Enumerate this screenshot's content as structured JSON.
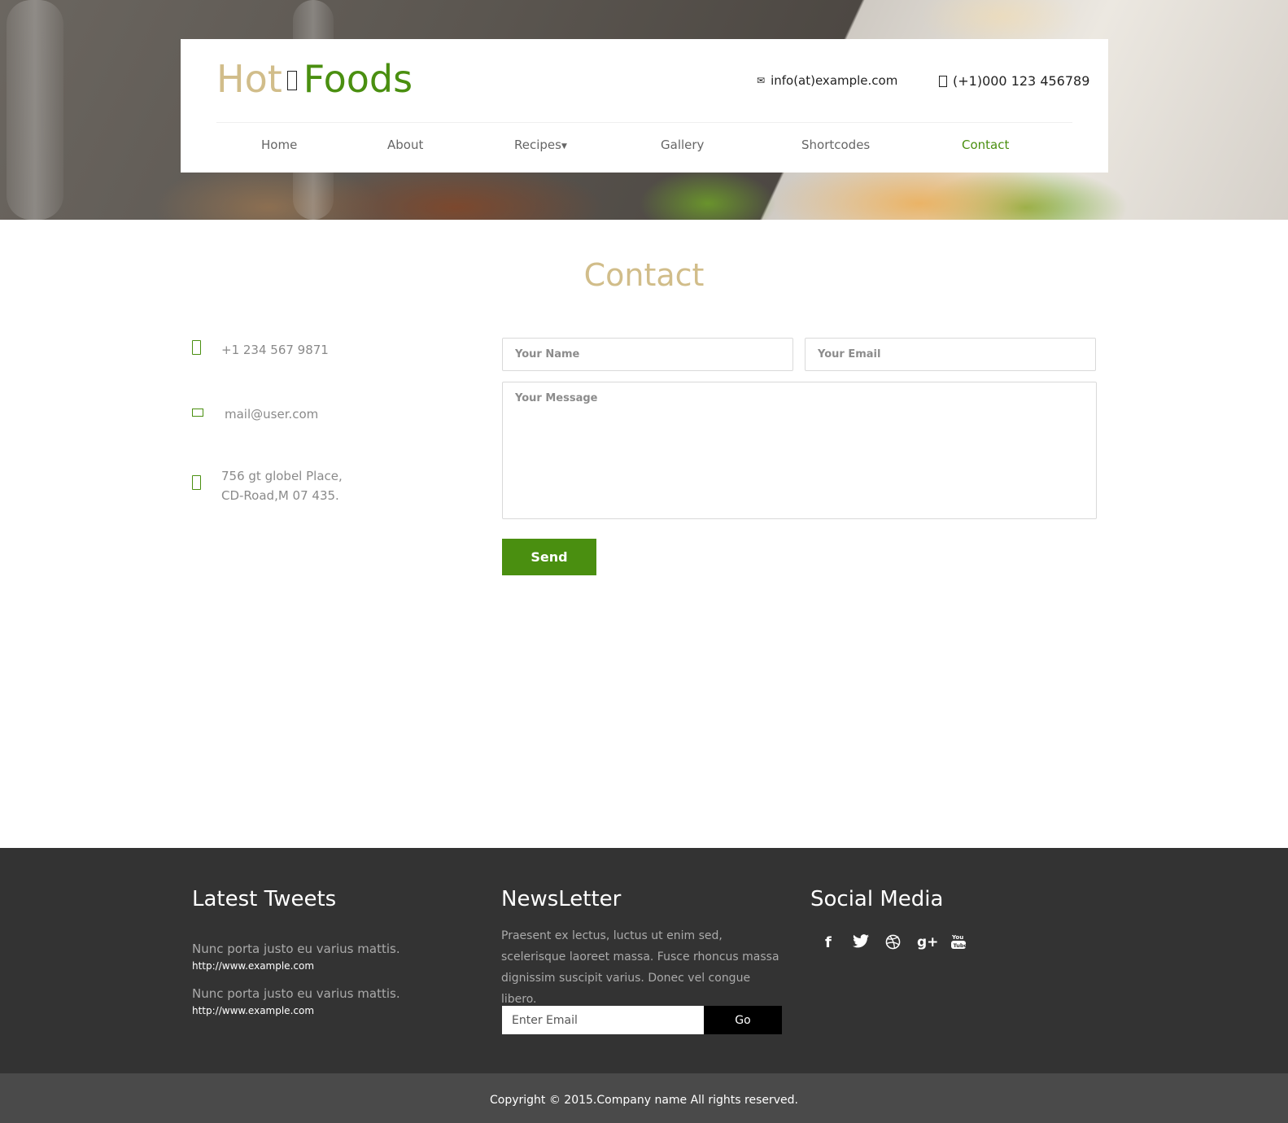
{
  "header": {
    "logo": {
      "part1": "Hot",
      "part2": "Foods"
    },
    "email": "info(at)example.com",
    "phone": "(+1)000 123 456789",
    "nav": [
      {
        "label": "Home"
      },
      {
        "label": "About"
      },
      {
        "label": "Recipes"
      },
      {
        "label": "Gallery"
      },
      {
        "label": "Shortcodes"
      },
      {
        "label": "Contact",
        "active": true
      }
    ]
  },
  "contact": {
    "title": "Contact",
    "phone": "+1 234 567 9871",
    "email": "mail@user.com",
    "address_line1": "756 gt globel Place,",
    "address_line2": "CD-Road,M 07 435.",
    "form": {
      "name_placeholder": "Your Name",
      "email_placeholder": "Your Email",
      "message_placeholder": "Your Message",
      "send_label": "Send"
    }
  },
  "footer": {
    "tweets": {
      "title": "Latest Tweets",
      "items": [
        {
          "text": "Nunc porta justo eu varius mattis.",
          "link": "http://www.example.com"
        },
        {
          "text": "Nunc porta justo eu varius mattis.",
          "link": "http://www.example.com"
        }
      ]
    },
    "newsletter": {
      "title": "NewsLetter",
      "text": "Praesent ex lectus, luctus ut enim sed, scelerisque laoreet massa. Fusce rhoncus massa dignissim suscipit varius. Donec vel congue libero.",
      "input_placeholder": "Enter Email",
      "button_label": "Go"
    },
    "social": {
      "title": "Social Media",
      "icons": [
        "facebook-icon",
        "twitter-icon",
        "dribbble-icon",
        "google-plus-icon",
        "youtube-icon"
      ]
    },
    "copyright": "Copyright © 2015.Company name All rights reserved."
  },
  "colors": {
    "accent_green": "#4a8f10",
    "accent_gold": "#d1bd8a",
    "footer_bg": "#333333",
    "copyright_bg": "#4a4a4a"
  }
}
